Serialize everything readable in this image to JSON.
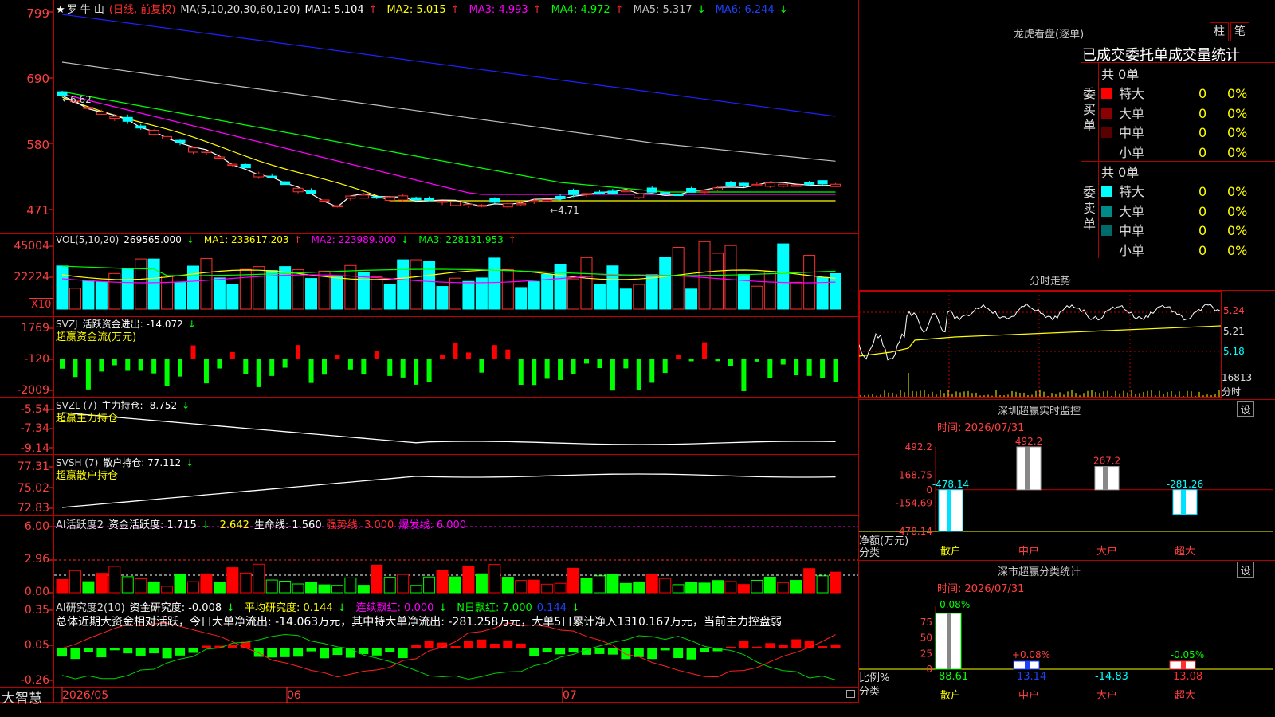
{
  "app": {
    "brand": "大智慧"
  },
  "stock": {
    "star": "★",
    "name": "罗 牛 山",
    "mode": "(日线, 前复权)"
  },
  "colors": {
    "up": "#ff3030",
    "down": "#00ffff",
    "ma1": "#ffffff",
    "ma2": "#ffff00",
    "ma3": "#ff00ff",
    "ma4": "#00ff00",
    "ma5": "#c0c0c0",
    "ma6": "#2020ff",
    "axis": "#ff3030",
    "grid": "#b00000"
  },
  "price_panel": {
    "header": {
      "ma_params": "MA(5,10,20,30,60,120)",
      "ma1": "MA1: 5.104",
      "ma1_arrow": "↑",
      "ma2": "MA2: 5.015",
      "ma2_arrow": "↑",
      "ma3": "MA3: 4.993",
      "ma3_arrow": "↑",
      "ma4": "MA4: 4.972",
      "ma4_arrow": "↑",
      "ma5": "MA5: 5.317",
      "ma5_arrow": "↓",
      "ma6": "MA6: 6.244",
      "ma6_arrow": "↓"
    },
    "y_labels": [
      "799",
      "690",
      "580",
      "471"
    ],
    "high_marker": "6.62",
    "low_marker": "4.71"
  },
  "vol_panel": {
    "header": {
      "name": "VOL(5,10,20)",
      "value": "269565.000",
      "arrow": "↓",
      "ma1": "MA1: 233617.203",
      "ma1_arrow": "↑",
      "ma2": "MA2: 223989.000",
      "ma2_arrow": "↓",
      "ma3": "MA3: 228131.953",
      "ma3_arrow": "↑"
    },
    "y_labels": [
      "45004",
      "22224"
    ],
    "unit": "X10"
  },
  "svzj_panel": {
    "header": {
      "name": "SVZJ",
      "label": "活跃资金进出: -14.072",
      "arrow": "↓",
      "sub": "超赢资金流(万元)"
    },
    "y_labels": [
      "1769",
      "-120",
      "-2009"
    ]
  },
  "svzl_panel": {
    "header": {
      "name": "SVZL (7)",
      "label": "主力持仓: -8.752",
      "arrow": "↓",
      "sub": "超赢主力持仓"
    },
    "y_labels": [
      "-5.54",
      "-7.34",
      "-9.14"
    ]
  },
  "svsh_panel": {
    "header": {
      "name": "SVSH (7)",
      "label": "散户持仓: 77.112",
      "arrow": "↓",
      "sub": "超赢散户持仓"
    },
    "y_labels": [
      "77.31",
      "75.02",
      "72.83"
    ]
  },
  "ai1_panel": {
    "header": {
      "name": "AI活跃度2",
      "label": "资金活跃度: 1.715",
      "arrow": "↓",
      "v2": "2.642",
      "life": "生命线: 1.560",
      "strong": "强势线: 3.000",
      "burst": "爆发线: 6.000"
    },
    "y_labels": [
      "6.00",
      "2.96",
      "0.00"
    ]
  },
  "ai2_panel": {
    "header": {
      "name": "AI研究度2(10)",
      "label": "资金研究度: -0.008",
      "arrow": "↓",
      "avg": "平均研究度: 0.144",
      "avg_arrow": "↓",
      "cont": "连续飘红: 0.000",
      "cont_arrow": "↓",
      "nday": "N日飘红: 7.000",
      "v5": "0.144",
      "v5_arrow": "↓"
    },
    "summary": "总体近期大资金相对活跃，今日大单净流出: -14.063万元，其中特大单净流出: -281.258万元，大单5日累计净入1310.167万元，当前主力控盘弱",
    "y_labels": [
      "0.35",
      "0.05",
      "-0.26"
    ]
  },
  "x_axis": {
    "labels": [
      "2026/05",
      "06",
      "07"
    ]
  },
  "right_panel": {
    "longhu": {
      "title": "龙虎看盘(逐单)",
      "tab1": "柱",
      "tab2": "笔",
      "heading": "已成交委托单成交量统计",
      "buy": {
        "side": "委买单",
        "total": "共 0单",
        "rows": [
          {
            "name": "特大",
            "count": "0",
            "pct": "0%",
            "color": "#ff0000"
          },
          {
            "name": "大单",
            "count": "0",
            "pct": "0%",
            "color": "#8b0000"
          },
          {
            "name": "中单",
            "count": "0",
            "pct": "0%",
            "color": "#5a0000"
          },
          {
            "name": "小单",
            "count": "0",
            "pct": "0%",
            "color": ""
          }
        ]
      },
      "sell": {
        "side": "委卖单",
        "total": "共 0单",
        "rows": [
          {
            "name": "特大",
            "count": "0",
            "pct": "0%",
            "color": "#00ffff"
          },
          {
            "name": "大单",
            "count": "0",
            "pct": "0%",
            "color": "#008b8b"
          },
          {
            "name": "中单",
            "count": "0",
            "pct": "0%",
            "color": "#006a6a"
          },
          {
            "name": "小单",
            "count": "0",
            "pct": "0%",
            "color": ""
          }
        ]
      }
    },
    "intraday": {
      "title": "分时走势",
      "y_labels": [
        "5.24",
        "5.21",
        "5.18"
      ],
      "vol_label": "16813",
      "time_label": "分时"
    },
    "monitor": {
      "title": "深圳超赢实时监控",
      "settings": "设",
      "time": "时间: 2026/07/31",
      "y_labels": [
        "492.2",
        "168.75",
        "0",
        "-154.69",
        "-478.14"
      ],
      "net_label": "净额(万元)",
      "cat_label": "分类",
      "categories": [
        "散户",
        "中户",
        "大户",
        "超大"
      ],
      "values": [
        -478.14,
        492.2,
        267.2,
        -281.26
      ],
      "value_labels": [
        "-478.14",
        "492.2",
        "267.2",
        "-281.26"
      ]
    },
    "classify": {
      "title": "深市超赢分类统计",
      "settings": "设",
      "time": "时间: 2026/07/31",
      "y_labels": [
        "75",
        "50",
        "25",
        "0"
      ],
      "ratio_label": "比例%",
      "cat_label": "分类",
      "categories": [
        "散户",
        "中户",
        "大户",
        "超大"
      ],
      "pct_labels": [
        "-0.08%",
        "+0.08%",
        "",
        "-0.05%"
      ],
      "values": [
        88.61,
        13.14,
        -14.83,
        13.08
      ],
      "value_labels": [
        "88.61",
        "13.14",
        "-14.83",
        "13.08"
      ]
    }
  },
  "chart_data": {
    "type": "bar",
    "title": "深圳超赢实时监控",
    "categories": [
      "散户",
      "中户",
      "大户",
      "超大"
    ],
    "series": [
      {
        "name": "净额(万元)",
        "values": [
          -478.14,
          492.2,
          267.2,
          -281.26
        ]
      }
    ],
    "ylim": [
      -478.14,
      492.2
    ]
  }
}
